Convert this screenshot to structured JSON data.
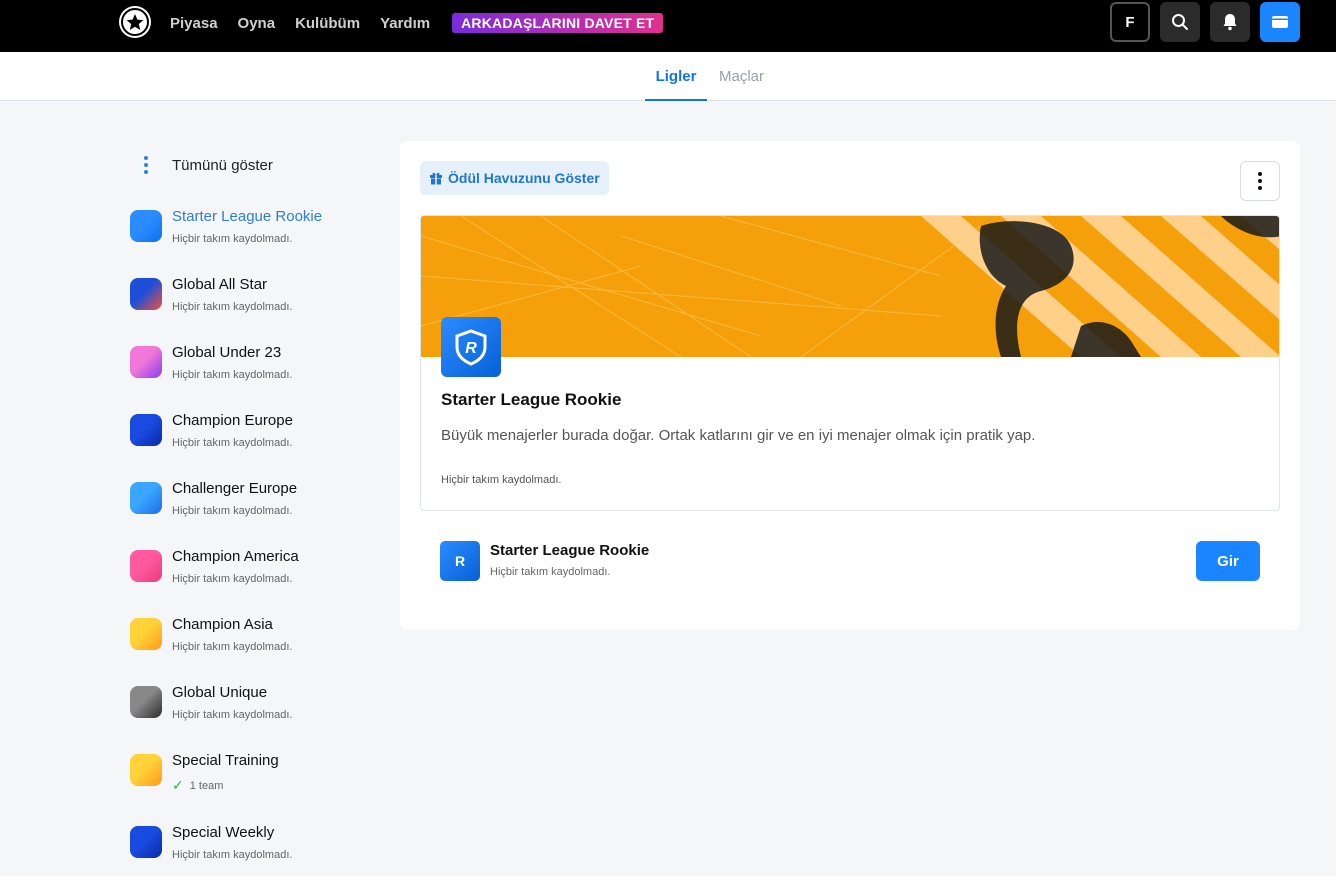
{
  "topbar": {
    "nav": [
      "Piyasa",
      "Oyna",
      "Kulübüm",
      "Yardım"
    ],
    "invite_label": "ARKADAŞLARINI DAVET ET",
    "profile_initial": "F"
  },
  "tabs": {
    "active": "Ligler",
    "inactive": "Maçlar"
  },
  "sidebar": {
    "show_all": "Tümünü göster",
    "leagues": [
      {
        "name": "Starter League Rookie",
        "status": "Hiçbir takım kaydolmadı.",
        "color_a": "#2a8cff",
        "color_b": "#1170f0"
      },
      {
        "name": "Global All Star",
        "status": "Hiçbir takım kaydolmadı.",
        "color_a": "#1f4fd8",
        "color_b": "#f0503c"
      },
      {
        "name": "Global Under 23",
        "status": "Hiçbir takım kaydolmadı.",
        "color_a": "#f078d8",
        "color_b": "#8a3cf0"
      },
      {
        "name": "Champion Europe",
        "status": "Hiçbir takım kaydolmadı.",
        "color_a": "#1a4be0",
        "color_b": "#0a2aa8"
      },
      {
        "name": "Challenger Europe",
        "status": "Hiçbir takım kaydolmadı.",
        "color_a": "#3aa6ff",
        "color_b": "#1a6ee8"
      },
      {
        "name": "Champion America",
        "status": "Hiçbir takım kaydolmadı.",
        "color_a": "#ff5aa0",
        "color_b": "#e83a7a"
      },
      {
        "name": "Champion Asia",
        "status": "Hiçbir takım kaydolmadı.",
        "color_a": "#ffd23a",
        "color_b": "#ff9a1a"
      },
      {
        "name": "Global Unique",
        "status": "Hiçbir takım kaydolmadı.",
        "color_a": "#888888",
        "color_b": "#2a2a2a"
      },
      {
        "name": "Special Training",
        "status": "1 team",
        "color_a": "#ffd23a",
        "color_b": "#ff9a1a"
      },
      {
        "name": "Special Weekly",
        "status": "Hiçbir takım kaydolmadı.",
        "color_a": "#1a4be0",
        "color_b": "#0a2aa8"
      }
    ]
  },
  "main": {
    "prize_button": "Ödül Havuzunu Göster",
    "card": {
      "title": "Starter League Rookie",
      "description": "Büyük menajerler burada doğar. Ortak katlarını gir ve en iyi menajer olmak için pratik yap.",
      "status": "Hiçbir takım kaydolmadı."
    },
    "entry": {
      "badge_letter": "R",
      "title": "Starter League Rookie",
      "status": "Hiçbir takım kaydolmadı.",
      "button": "Gir"
    }
  }
}
